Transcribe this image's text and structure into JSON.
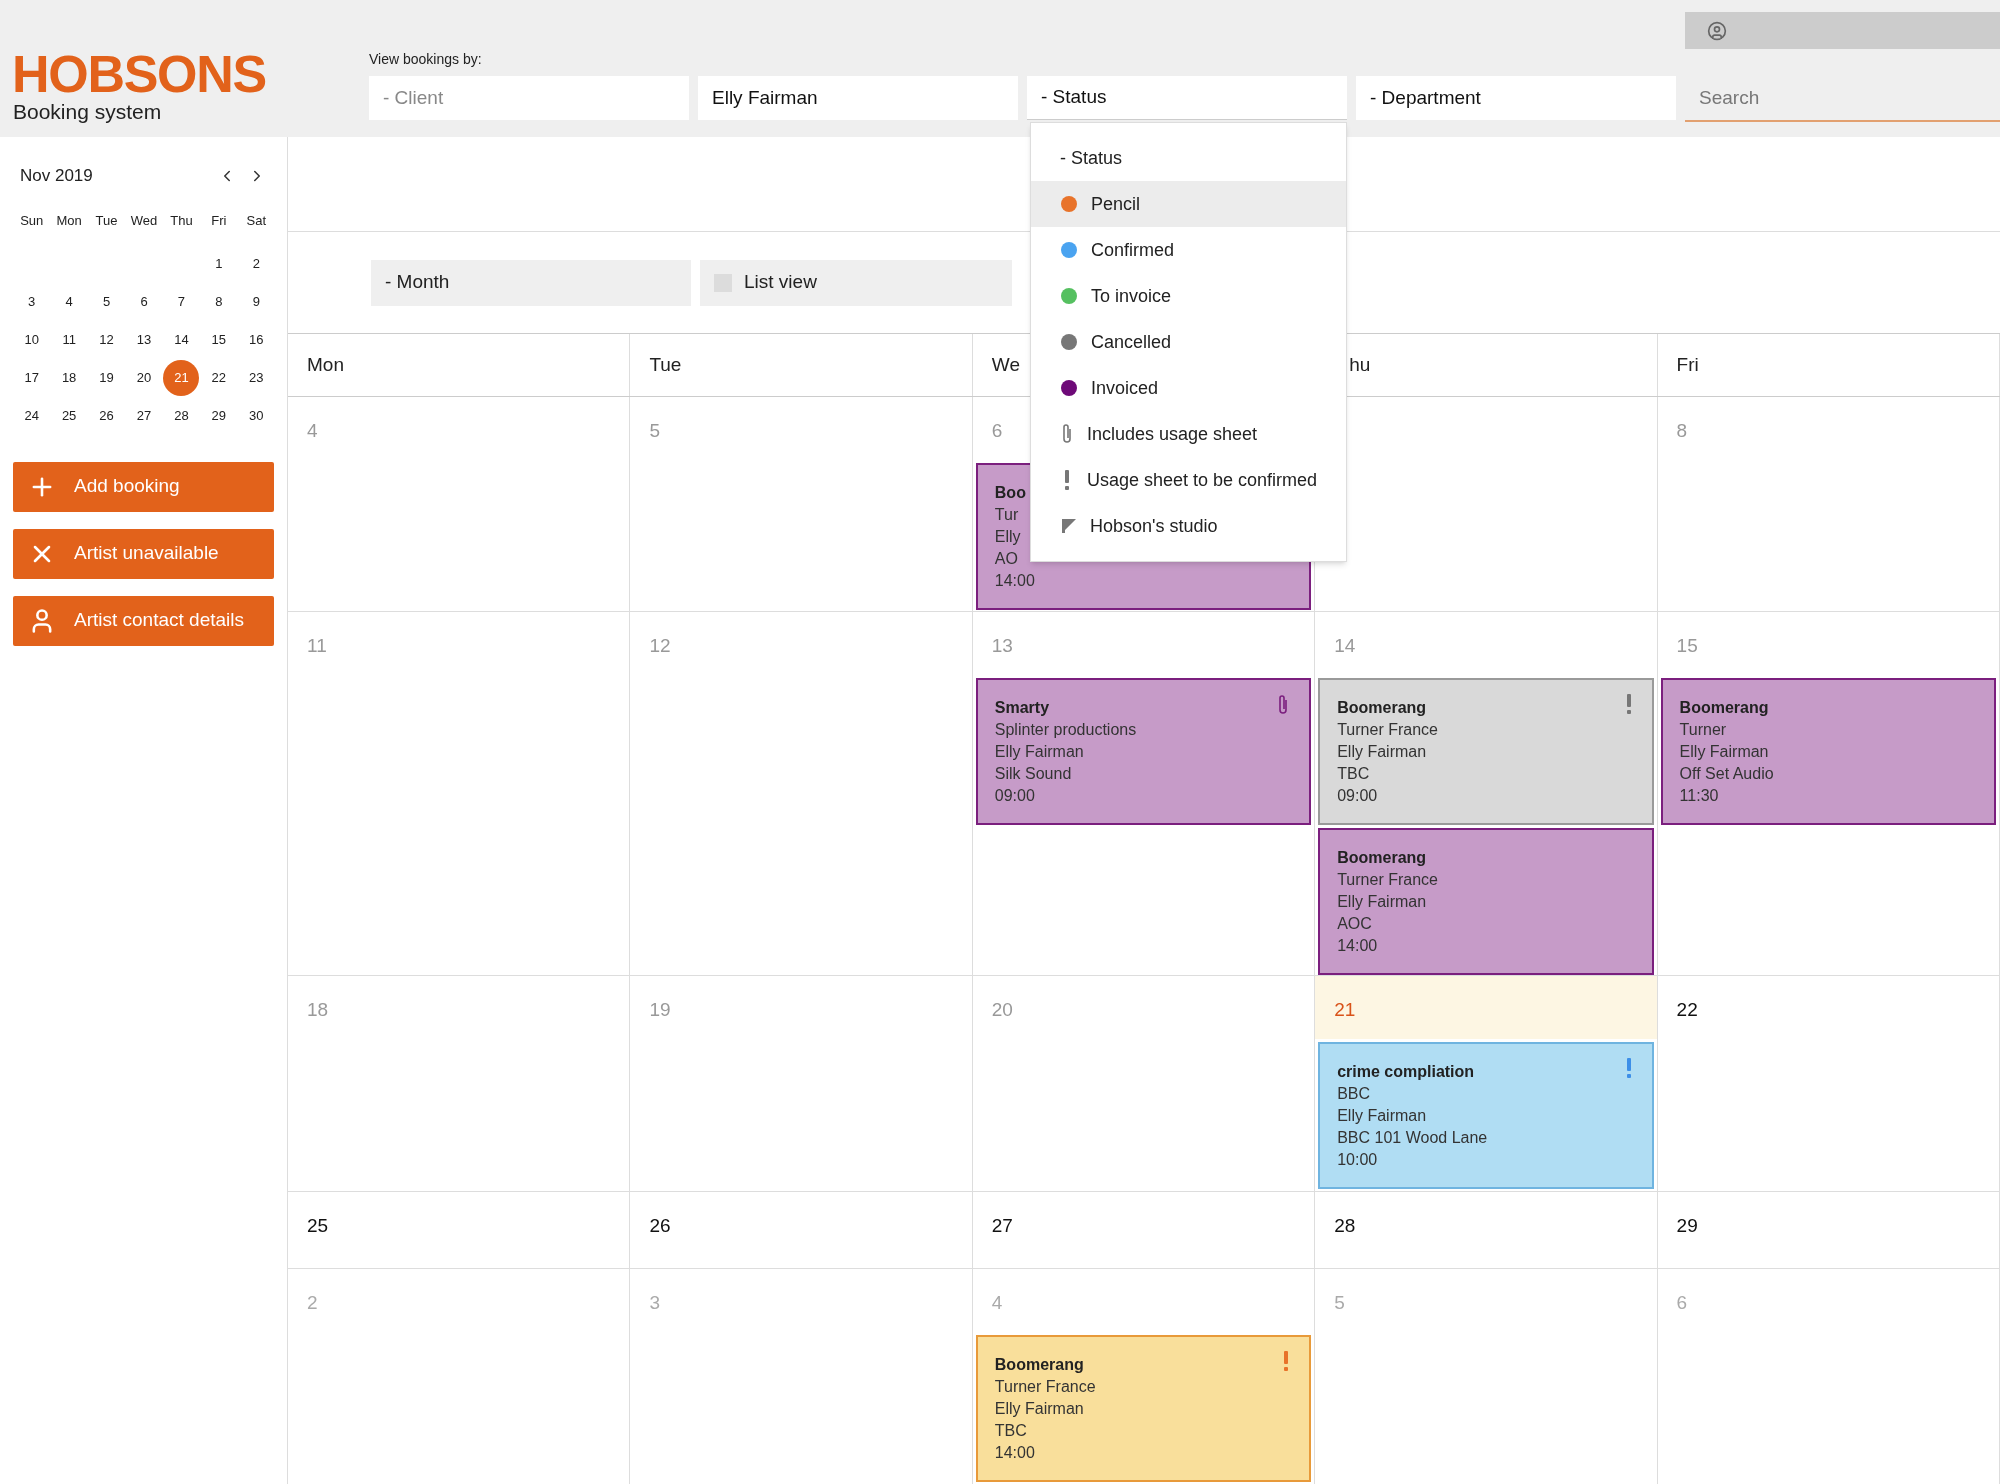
{
  "header": {
    "logo": "HOBSONS",
    "subtitle": "Booking system",
    "filter_label": "View bookings by:",
    "filters": [
      {
        "placeholder": "- Client"
      },
      {
        "value": "Elly Fairman"
      },
      {
        "value": "- Status",
        "open": true
      },
      {
        "value": "- Department"
      }
    ],
    "search": {
      "placeholder": "Search"
    }
  },
  "mini_calendar": {
    "month": "Nov 2019",
    "weekdays": [
      "Sun",
      "Mon",
      "Tue",
      "Wed",
      "Thu",
      "Fri",
      "Sat"
    ],
    "weeks": [
      [
        {
          "day": "1",
          "selected": false
        },
        {
          "day": "2",
          "selected": false
        }
      ],
      [
        {
          "day": "3",
          "selected": false
        },
        {
          "day": "4",
          "selected": false
        },
        {
          "day": "5",
          "selected": false
        },
        {
          "day": "6",
          "selected": false
        },
        {
          "day": "7",
          "selected": false
        },
        {
          "day": "8",
          "selected": false
        },
        {
          "day": "9",
          "selected": false
        }
      ],
      [
        {
          "day": "10",
          "selected": false
        },
        {
          "day": "11",
          "selected": false
        },
        {
          "day": "12",
          "selected": false
        },
        {
          "day": "13",
          "selected": false
        },
        {
          "day": "14",
          "selected": false
        },
        {
          "day": "15",
          "selected": false
        },
        {
          "day": "16",
          "selected": false
        }
      ],
      [
        {
          "day": "17",
          "selected": false
        },
        {
          "day": "18",
          "selected": false
        },
        {
          "day": "19",
          "selected": false
        },
        {
          "day": "20",
          "selected": false
        },
        {
          "day": "21",
          "selected": true
        },
        {
          "day": "22",
          "selected": false
        },
        {
          "day": "23",
          "selected": false
        }
      ],
      [
        {
          "day": "24",
          "selected": false
        },
        {
          "day": "25",
          "selected": false
        },
        {
          "day": "26",
          "selected": false
        },
        {
          "day": "27",
          "selected": false
        },
        {
          "day": "28",
          "selected": false
        },
        {
          "day": "29",
          "selected": false
        },
        {
          "day": "30",
          "selected": false
        }
      ]
    ]
  },
  "actions": [
    {
      "kind": "add",
      "label": "Add booking"
    },
    {
      "kind": "unavailable",
      "label": "Artist unavailable"
    },
    {
      "kind": "contact",
      "label": "Artist contact details"
    }
  ],
  "view_controls": {
    "period": "- Month",
    "list_view": {
      "label": "List view",
      "checked": false
    }
  },
  "calendar": {
    "columns": [
      "Mon",
      "Tue",
      "We",
      "hu",
      "Fri"
    ],
    "weeks": [
      {
        "days": [
          {
            "day": "4",
            "kind": "past"
          },
          {
            "day": "5",
            "kind": "past"
          },
          {
            "day": "6",
            "kind": "past",
            "events": [
              {
                "kind": "invoiced",
                "lines": [
                  "Boo",
                  "Tur",
                  "Elly",
                  "AO",
                  "14:00"
                ]
              }
            ]
          },
          {
            "kind": "past"
          },
          {
            "day": "8",
            "kind": "past"
          }
        ]
      },
      {
        "days": [
          {
            "day": "11",
            "kind": "past"
          },
          {
            "day": "12",
            "kind": "past"
          },
          {
            "day": "13",
            "kind": "past",
            "events": [
              {
                "kind": "invoiced",
                "attachment": true,
                "lines": [
                  "Smarty",
                  "Splinter productions",
                  "Elly Fairman",
                  "Silk Sound",
                  "09:00"
                ]
              }
            ]
          },
          {
            "day": "14",
            "kind": "past",
            "events": [
              {
                "kind": "cancelled",
                "usage_alert": true,
                "lines": [
                  "Boomerang",
                  "Turner France",
                  "Elly Fairman",
                  "TBC",
                  "09:00"
                ]
              },
              {
                "kind": "invoiced",
                "lines": [
                  "Boomerang",
                  "Turner France",
                  "Elly Fairman",
                  "AOC",
                  "14:00"
                ]
              }
            ]
          },
          {
            "day": "15",
            "kind": "past",
            "events": [
              {
                "kind": "invoiced",
                "lines": [
                  "Boomerang",
                  "Turner",
                  "Elly Fairman",
                  "Off Set Audio",
                  "11:30"
                ]
              }
            ]
          }
        ]
      },
      {
        "days": [
          {
            "day": "18",
            "kind": "past"
          },
          {
            "day": "19",
            "kind": "past"
          },
          {
            "day": "20",
            "kind": "past"
          },
          {
            "day": "21",
            "kind": "today",
            "events": [
              {
                "kind": "confirmed",
                "usage_alert": true,
                "lines": [
                  "crime compliation",
                  "BBC",
                  "Elly Fairman",
                  "BBC 101 Wood Lane",
                  "10:00"
                ]
              }
            ]
          },
          {
            "day": "22",
            "kind": "upcoming"
          }
        ]
      },
      {
        "days": [
          {
            "day": "25",
            "kind": "upcoming"
          },
          {
            "day": "26",
            "kind": "upcoming"
          },
          {
            "day": "27",
            "kind": "upcoming"
          },
          {
            "day": "28",
            "kind": "upcoming"
          },
          {
            "day": "29",
            "kind": "upcoming"
          }
        ]
      },
      {
        "days": [
          {
            "day": "2",
            "kind": "other_month"
          },
          {
            "day": "3",
            "kind": "other_month"
          },
          {
            "day": "4",
            "kind": "other_month",
            "events": [
              {
                "kind": "pencil",
                "usage_alert": true,
                "lines": [
                  "Boomerang",
                  "Turner France",
                  "Elly Fairman",
                  "TBC",
                  "14:00"
                ]
              }
            ]
          },
          {
            "day": "5",
            "kind": "other_month"
          },
          {
            "day": "6",
            "kind": "other_month"
          }
        ]
      }
    ]
  },
  "status_menu": {
    "items": [
      {
        "kind": "plain",
        "label": "- Status",
        "highlighted": false
      },
      {
        "kind": "dot",
        "label": "Pencil",
        "color": "#e8732a",
        "highlighted": true
      },
      {
        "kind": "dot",
        "label": "Confirmed",
        "color": "#4aa3f0",
        "highlighted": false
      },
      {
        "kind": "dot",
        "label": "To invoice",
        "color": "#55c060",
        "highlighted": false
      },
      {
        "kind": "dot",
        "label": "Cancelled",
        "color": "#777777",
        "highlighted": false
      },
      {
        "kind": "dot",
        "label": "Invoiced",
        "color": "#6e0a78",
        "highlighted": false
      },
      {
        "kind": "attachment",
        "label": "Includes usage sheet",
        "highlighted": false
      },
      {
        "kind": "alert",
        "label": "Usage sheet to be confirmed",
        "highlighted": false
      },
      {
        "kind": "corner",
        "label": "Hobson's studio",
        "highlighted": false
      }
    ]
  }
}
